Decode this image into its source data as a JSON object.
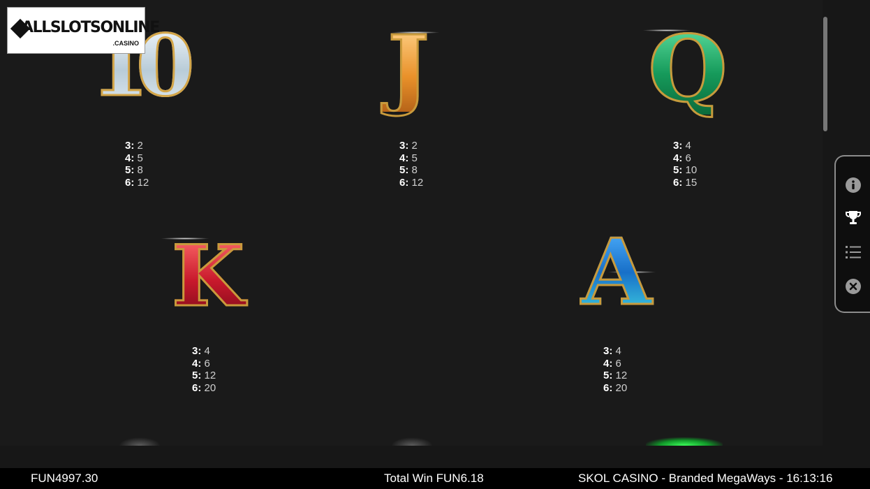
{
  "logo": {
    "main": "ALLSLOTSONLINE",
    "sub": ".CASINO"
  },
  "symbols": [
    {
      "id": "ten",
      "glyph": "10",
      "pays": [
        {
          "k": "3:",
          "v": "2"
        },
        {
          "k": "4:",
          "v": "5"
        },
        {
          "k": "5:",
          "v": "8"
        },
        {
          "k": "6:",
          "v": "12"
        }
      ]
    },
    {
      "id": "jack",
      "glyph": "J",
      "pays": [
        {
          "k": "3:",
          "v": "2"
        },
        {
          "k": "4:",
          "v": "5"
        },
        {
          "k": "5:",
          "v": "8"
        },
        {
          "k": "6:",
          "v": "12"
        }
      ]
    },
    {
      "id": "queen",
      "glyph": "Q",
      "pays": [
        {
          "k": "3:",
          "v": "4"
        },
        {
          "k": "4:",
          "v": "6"
        },
        {
          "k": "5:",
          "v": "10"
        },
        {
          "k": "6:",
          "v": "15"
        }
      ]
    },
    {
      "id": "king",
      "glyph": "K",
      "pays": [
        {
          "k": "3:",
          "v": "4"
        },
        {
          "k": "4:",
          "v": "6"
        },
        {
          "k": "5:",
          "v": "12"
        },
        {
          "k": "6:",
          "v": "20"
        }
      ]
    },
    {
      "id": "ace",
      "glyph": "A",
      "pays": [
        {
          "k": "3:",
          "v": "4"
        },
        {
          "k": "4:",
          "v": "6"
        },
        {
          "k": "5:",
          "v": "12"
        },
        {
          "k": "6:",
          "v": "20"
        }
      ]
    }
  ],
  "menu": {
    "icons": [
      "info-icon",
      "trophy-icon",
      "list-icon",
      "close-icon"
    ]
  },
  "footer": {
    "balance": "FUN4997.30",
    "total_win": "Total Win FUN6.18",
    "info": "SKOL CASINO - Branded MegaWays - 16:13:16"
  },
  "colors": {
    "background": "#1a1a1a",
    "footer": "#000000",
    "gold_outline": "#c89a3c"
  }
}
